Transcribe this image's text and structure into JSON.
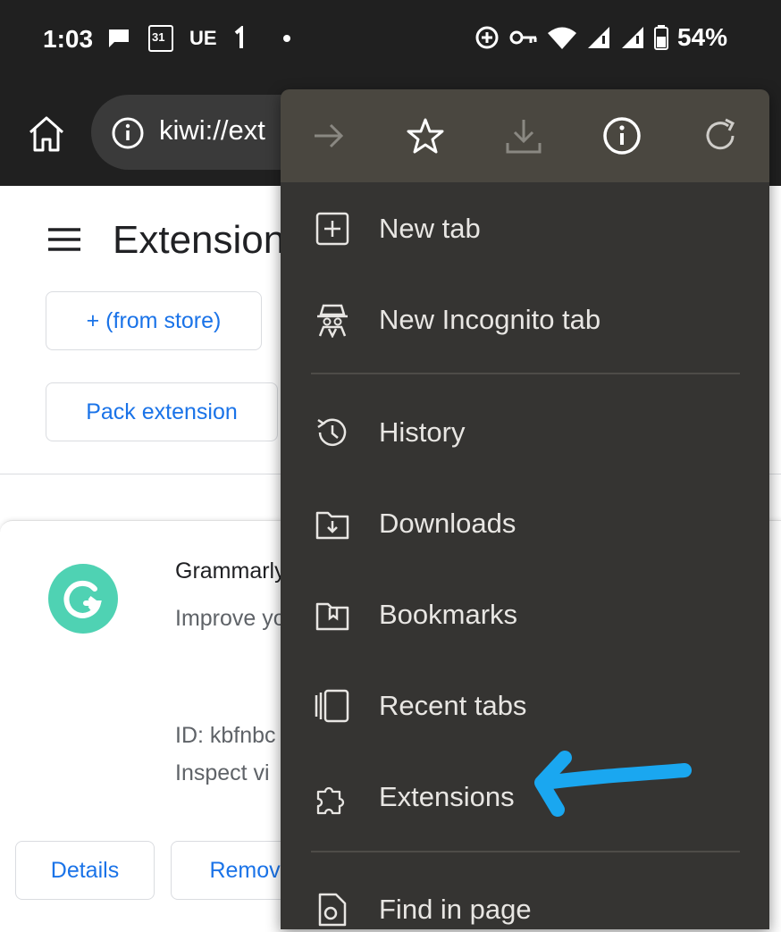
{
  "status_bar": {
    "time": "1:03",
    "carrier_tag": "UE",
    "calendar_day": "31",
    "battery_percent": "54%",
    "icons": [
      "chat-bubble-icon",
      "calendar-icon",
      "carrier-icon",
      "dot-icon",
      "target-icon",
      "key-icon",
      "wifi-icon",
      "signal-icon",
      "signal-icon",
      "battery-icon"
    ]
  },
  "toolbar": {
    "url": "kiwi://ext",
    "home_icon": "home-icon",
    "info_icon": "info-icon"
  },
  "page": {
    "title": "Extensions",
    "from_store_button": "+ (from store)",
    "pack_extension_button": "Pack extension",
    "extension": {
      "name": "Grammarly",
      "description": "Improve your writing communication with grammar",
      "id_line": "ID: kbfnbc",
      "inspect_line": "Inspect vi",
      "details_button": "Details",
      "remove_button": "Remove"
    }
  },
  "menu": {
    "icon_row": [
      "forward-arrow-icon",
      "star-icon",
      "download-icon",
      "info-icon",
      "refresh-icon"
    ],
    "items": [
      {
        "label": "New tab",
        "icon": "new-tab-icon"
      },
      {
        "label": "New Incognito tab",
        "icon": "incognito-icon"
      },
      {
        "label": "History",
        "icon": "history-icon"
      },
      {
        "label": "Downloads",
        "icon": "downloads-folder-icon"
      },
      {
        "label": "Bookmarks",
        "icon": "bookmarks-folder-icon"
      },
      {
        "label": "Recent tabs",
        "icon": "recent-tabs-icon"
      },
      {
        "label": "Extensions",
        "icon": "puzzle-icon"
      },
      {
        "label": "Find in page",
        "icon": "find-in-page-icon"
      }
    ]
  },
  "colors": {
    "status_bg": "#202020",
    "menu_bg": "#353432",
    "menu_iconrow_bg": "#4a4740",
    "link_blue": "#1a73e8",
    "annotation_arrow": "#1aa7f0",
    "grammarly_green": "#15c39a"
  }
}
